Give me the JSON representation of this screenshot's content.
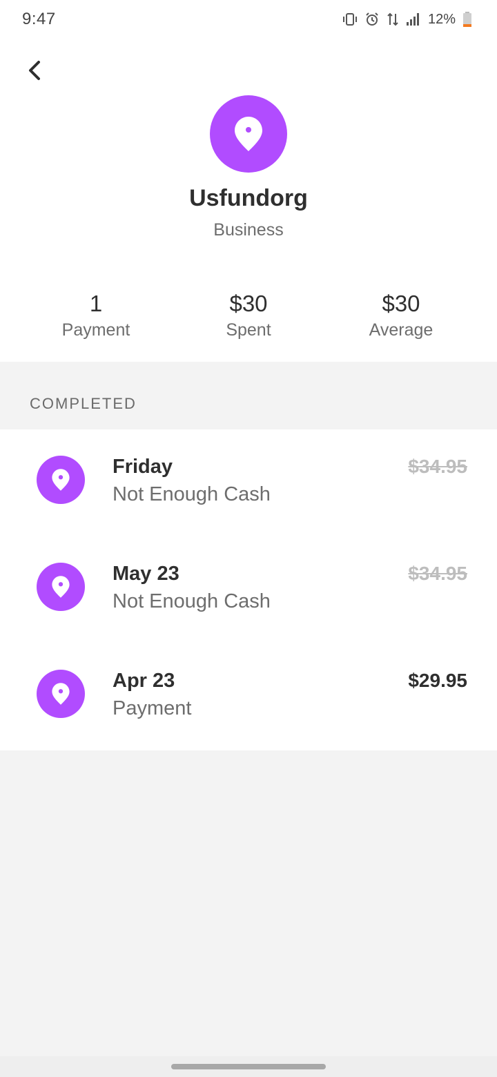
{
  "status_bar": {
    "time": "9:47",
    "battery_percent": "12%",
    "icons": [
      "vibrate-icon",
      "alarm-icon",
      "data-icon",
      "signal-icon",
      "battery-icon"
    ]
  },
  "header": {
    "back_icon": "chevron-left-icon",
    "avatar_icon": "location-pin-icon",
    "name": "Usfundorg",
    "type": "Business"
  },
  "stats": [
    {
      "value": "1",
      "label": "Payment"
    },
    {
      "value": "$30",
      "label": "Spent"
    },
    {
      "value": "$30",
      "label": "Average"
    }
  ],
  "section": {
    "title": "COMPLETED"
  },
  "transactions": [
    {
      "title": "Friday",
      "subtitle": "Not Enough Cash",
      "amount": "$34.95",
      "struck": true
    },
    {
      "title": "May 23",
      "subtitle": "Not Enough Cash",
      "amount": "$34.95",
      "struck": true
    },
    {
      "title": "Apr 23",
      "subtitle": "Payment",
      "amount": "$29.95",
      "struck": false
    }
  ],
  "colors": {
    "accent": "#b14cff",
    "background": "#f3f3f3",
    "battery_low": "#f37a1f"
  }
}
